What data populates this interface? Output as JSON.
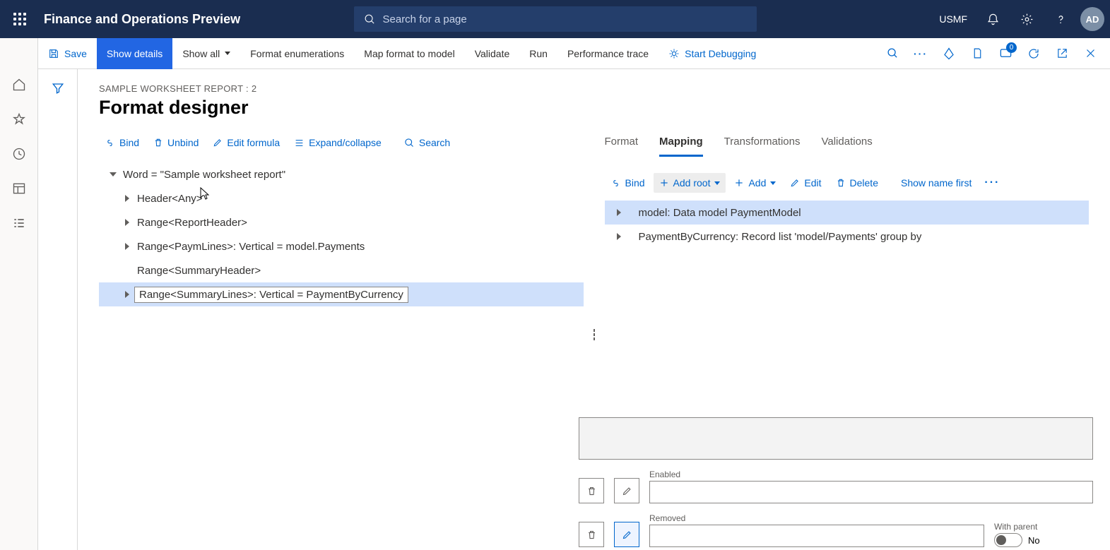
{
  "topbar": {
    "title": "Finance and Operations Preview",
    "search_placeholder": "Search for a page",
    "entity": "USMF",
    "avatar": "AD"
  },
  "actionbar": {
    "save": "Save",
    "show_details": "Show details",
    "show_all": "Show all",
    "format_enum": "Format enumerations",
    "map_format": "Map format to model",
    "validate": "Validate",
    "run": "Run",
    "perf": "Performance trace",
    "start_debug": "Start Debugging",
    "badge_count": "0"
  },
  "page": {
    "breadcrumb": "SAMPLE WORKSHEET REPORT : 2",
    "title": "Format designer"
  },
  "left_toolbar": {
    "bind": "Bind",
    "unbind": "Unbind",
    "edit_formula": "Edit formula",
    "expand": "Expand/collapse",
    "search": "Search"
  },
  "format_tree": {
    "n0": "Word = \"Sample worksheet report\"",
    "n1": "Header<Any>",
    "n2": "Range<ReportHeader>",
    "n3": "Range<PaymLines>: Vertical = model.Payments",
    "n4": "Range<SummaryHeader>",
    "n5": "Range<SummaryLines>: Vertical = PaymentByCurrency"
  },
  "right_tabs": {
    "format": "Format",
    "mapping": "Mapping",
    "transformations": "Transformations",
    "validations": "Validations"
  },
  "right_toolbar": {
    "bind": "Bind",
    "add_root": "Add root",
    "add": "Add",
    "edit": "Edit",
    "delete": "Delete",
    "show_name_first": "Show name first"
  },
  "mapping_tree": {
    "m0": "model: Data model PaymentModel",
    "m1": "PaymentByCurrency: Record list 'model/Payments' group by"
  },
  "props": {
    "enabled_label": "Enabled",
    "removed_label": "Removed",
    "with_parent_label": "With parent",
    "with_parent_value": "No"
  }
}
